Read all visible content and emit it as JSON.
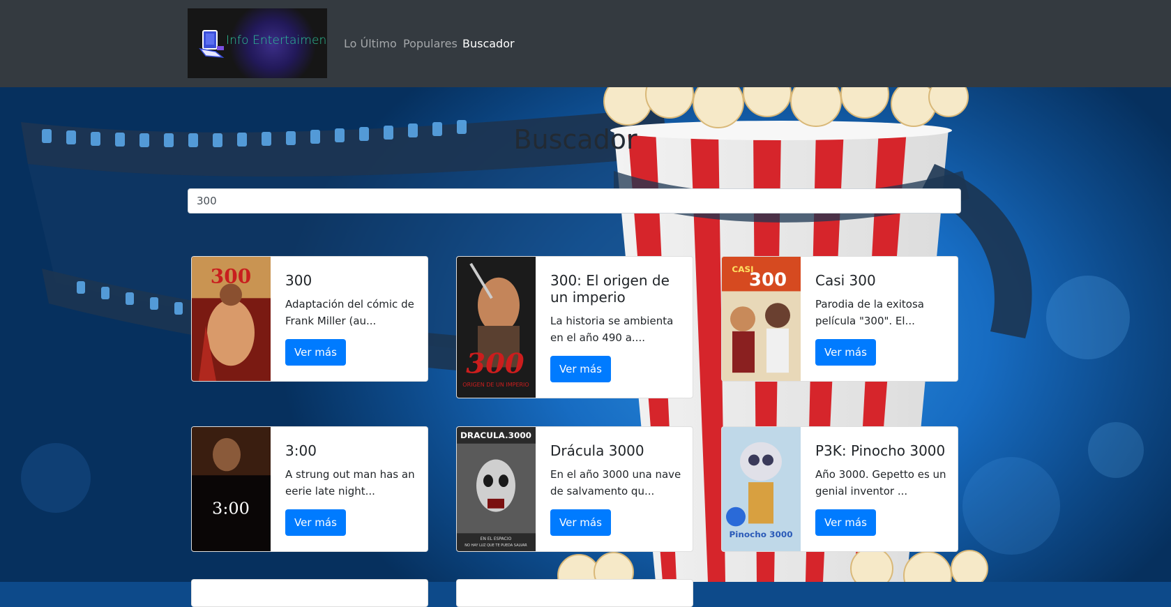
{
  "brand": {
    "logo_text": "Info Entertaiment"
  },
  "nav": {
    "items": [
      {
        "label": "Lo Último",
        "active": false
      },
      {
        "label": "Populares",
        "active": false
      },
      {
        "label": "Buscador",
        "active": true
      }
    ]
  },
  "page": {
    "title": "Buscador"
  },
  "search": {
    "value": "300",
    "placeholder": ""
  },
  "results": [
    {
      "title": "300",
      "description": "Adaptación del cómic de Frank Miller (au...",
      "button": "Ver más"
    },
    {
      "title": "300: El origen de un imperio",
      "description": "La historia se ambienta en el año 490 a....",
      "button": "Ver más"
    },
    {
      "title": "Casi 300",
      "description": "Parodia de la exitosa película \"300\". El...",
      "button": "Ver más"
    },
    {
      "title": "3:00",
      "description": "A strung out man has an eerie late night...",
      "button": "Ver más"
    },
    {
      "title": "Drácula 3000",
      "description": "En el año 3000 una nave de salvamento qu...",
      "button": "Ver más"
    },
    {
      "title": "P3K: Pinocho 3000",
      "description": "Año 3000. Gepetto es un genial inventor ...",
      "button": "Ver más"
    }
  ],
  "posters": {
    "p1": "300",
    "p2": "300",
    "p2b": "ORIGEN DE UN IMPERIO",
    "p3a": "CASI",
    "p3b": "300",
    "p4": "3:00",
    "p5a": "DRACULA.3000",
    "p5b": "EN EL ESPACIO",
    "p5c": "NO HAY LUZ QUE TE PUEDA SALVAR",
    "p6": "Pinocho 3000"
  },
  "colors": {
    "navbar": "#343a40",
    "primary": "#007bff",
    "brand_text": "#2ec49a"
  }
}
